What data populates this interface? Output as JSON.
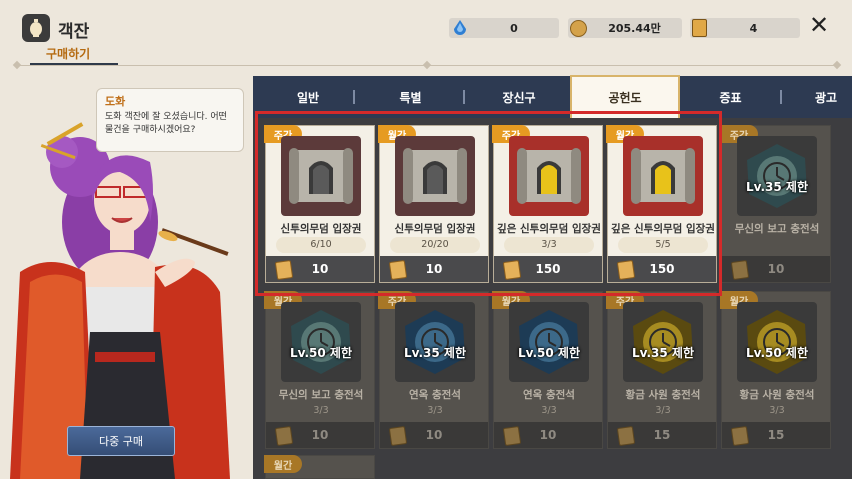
{
  "header": {
    "title": "객잔",
    "subtab": "구매하기"
  },
  "resources": [
    {
      "icon": "blue-gem-icon",
      "value": "0",
      "color": "#2f7fd3"
    },
    {
      "icon": "gold-coin-icon",
      "value": "205.44만",
      "color": "#d4a24a"
    },
    {
      "icon": "ticket-icon",
      "value": "4",
      "color": "#e0a847"
    }
  ],
  "npc": {
    "name": "도화",
    "greeting": "도화 객잔에 잘 오셨습니다. 어떤 물건을 구매하시겠어요?"
  },
  "multi_buy_label": "다중 구매",
  "tabs": [
    {
      "label": "일반"
    },
    {
      "label": "특별"
    },
    {
      "label": "장신구"
    },
    {
      "label": "공헌도",
      "active": true
    },
    {
      "label": "증표"
    },
    {
      "label": "광고"
    }
  ],
  "items": [
    {
      "badge": "주간",
      "name": "신투의무덤 입장권",
      "stock": "6/10",
      "price": "10",
      "type": "scroll-gray",
      "dim": false
    },
    {
      "badge": "월간",
      "name": "신투의무덤 입장권",
      "stock": "20/20",
      "price": "10",
      "type": "scroll-gray",
      "dim": false
    },
    {
      "badge": "주간",
      "name": "깊은 신투의무덤 입장권",
      "stock": "3/3",
      "price": "150",
      "type": "scroll-gold",
      "dim": false
    },
    {
      "badge": "월간",
      "name": "깊은 신투의무덤 입장권",
      "stock": "5/5",
      "price": "150",
      "type": "scroll-gold",
      "dim": false
    },
    {
      "badge": "주간",
      "name": "무신의 보고 충전석",
      "stock": "",
      "price": "10",
      "type": "stone-teal",
      "lv": "Lv.35 제한",
      "dim": true
    },
    {
      "badge": "월간",
      "name": "무신의 보고 충전석",
      "stock": "3/3",
      "price": "10",
      "type": "stone-teal",
      "lv": "Lv.50 제한",
      "dim": true
    },
    {
      "badge": "주간",
      "name": "연옥 충전석",
      "stock": "3/3",
      "price": "10",
      "type": "stone-blue",
      "lv": "Lv.35 제한",
      "dim": true
    },
    {
      "badge": "월간",
      "name": "연옥 충전석",
      "stock": "3/3",
      "price": "10",
      "type": "stone-blue",
      "lv": "Lv.50 제한",
      "dim": true
    },
    {
      "badge": "주간",
      "name": "황금 사원 충전석",
      "stock": "3/3",
      "price": "15",
      "type": "stone-gold",
      "lv": "Lv.35 제한",
      "dim": true
    },
    {
      "badge": "월간",
      "name": "황금 사원 충전석",
      "stock": "3/3",
      "price": "15",
      "type": "stone-gold",
      "lv": "Lv.50 제한",
      "dim": true
    },
    {
      "badge": "월간",
      "name": "",
      "stock": "",
      "price": "",
      "type": "",
      "dim": true
    }
  ]
}
